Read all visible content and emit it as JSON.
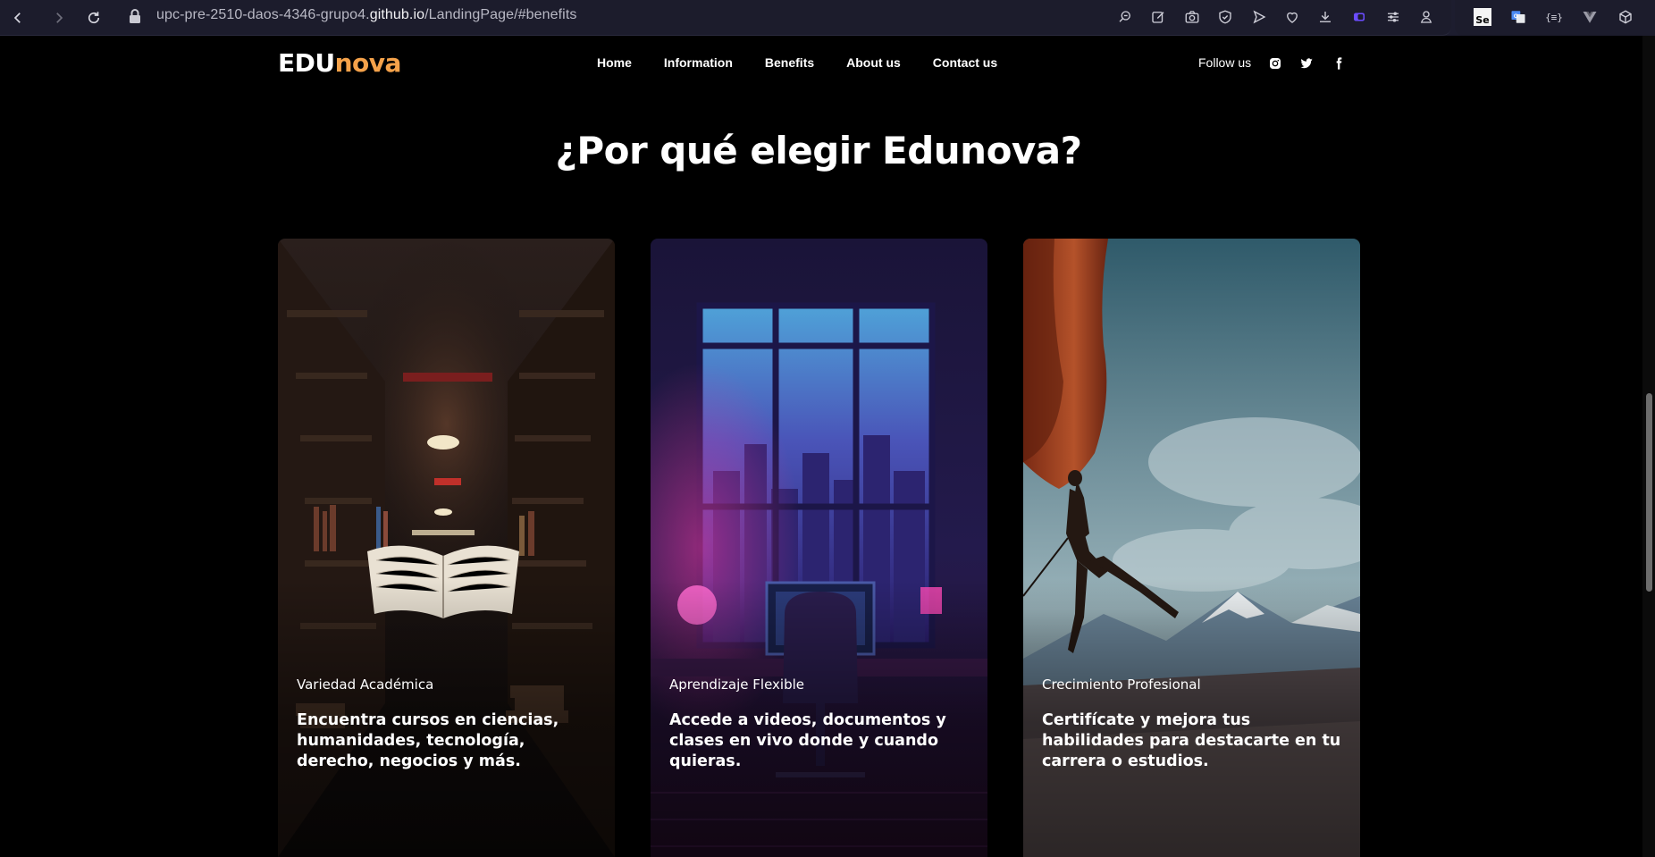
{
  "browser": {
    "url_prefix": "upc-pre-2510-daos-4346-grupo4.",
    "url_host": "github.io",
    "url_path": "/LandingPage/#benefits",
    "icons": [
      "back-icon",
      "forward-icon",
      "reload-icon",
      "lock-icon",
      "zoom-icon",
      "edit-icon",
      "camera-icon",
      "shield-icon",
      "send-icon",
      "heart-icon",
      "download-icon",
      "sidebar-icon",
      "menu-icon",
      "profile-icon",
      "se-extension-icon",
      "translate-extension-icon",
      "json-extension-icon",
      "vue-extension-icon",
      "cube-extension-icon"
    ],
    "ext_se_label": "Se",
    "ext_json_label": "{≡}"
  },
  "header": {
    "logo_part1": "EDU",
    "logo_part2": "nova",
    "logo_accent": "#f5a24a",
    "menu": [
      "Home",
      "Information",
      "Benefits",
      "About us",
      "Contact us"
    ],
    "follow_label": "Follow us",
    "social": [
      "instagram-icon",
      "twitter-icon",
      "facebook-icon"
    ]
  },
  "section": {
    "title": "¿Por qué elegir Edunova?"
  },
  "cards": [
    {
      "title": "Variedad Académica",
      "description": "Encuentra cursos en ciencias, humanidades, tecnología, derecho, negocios y más.",
      "image": "library-floating-book"
    },
    {
      "title": "Aprendizaje Flexible",
      "description": "Accede a videos, documentos y clases en vivo donde y cuando quieras.",
      "image": "neon-desk-window"
    },
    {
      "title": "Crecimiento Profesional",
      "description": "Certifícate y mejora tus habilidades para destacarte en tu carrera o estudios.",
      "image": "rock-climber-mountains"
    }
  ]
}
